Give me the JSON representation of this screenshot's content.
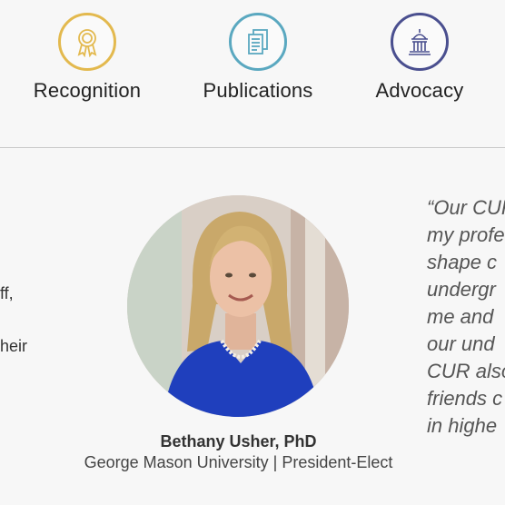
{
  "features": [
    {
      "label": "Recognition",
      "icon": "award-ribbon-icon",
      "color": "#e3b94e"
    },
    {
      "label": "Publications",
      "icon": "documents-icon",
      "color": "#5aa8c0"
    },
    {
      "label": "Advocacy",
      "icon": "capitol-building-icon",
      "color": "#4a4f8f"
    }
  ],
  "left_fragments": [
    "ff,",
    "heir"
  ],
  "testimonial": {
    "name": "Bethany Usher, PhD",
    "role": "George Mason University | President-Elect",
    "quote_lines": [
      "“Our CUR",
      "my profe",
      "shape c",
      "undergr",
      "me and",
      "our und",
      "CUR also",
      "friends c",
      "in highe"
    ]
  }
}
